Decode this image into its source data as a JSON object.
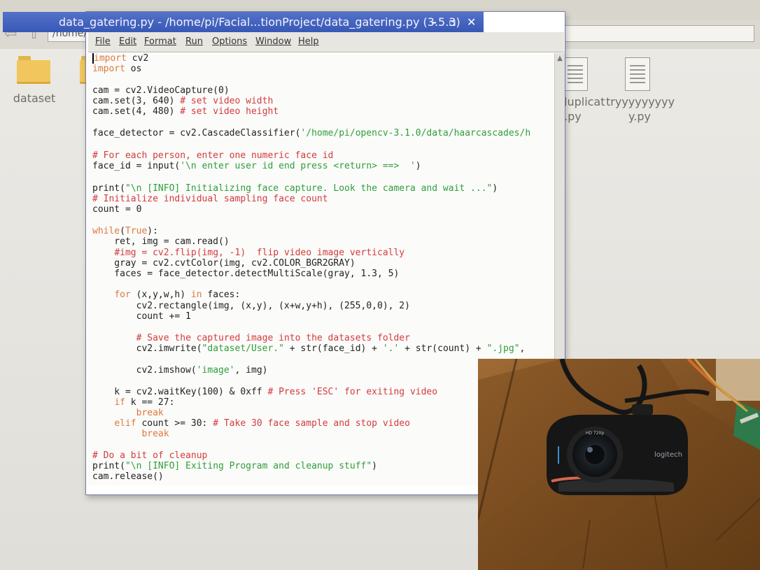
{
  "file_manager": {
    "path": "/home/",
    "items": [
      {
        "label": "dataset"
      },
      {
        "label": "luplicat\n.py"
      },
      {
        "label": "tryyyyyyyyy\ny.py"
      }
    ]
  },
  "idle_window": {
    "title": "data_gatering.py - /home/pi/Facial...tionProject/data_gatering.py (3.5.3)",
    "controls": {
      "minimize": "–",
      "maximize": "▫",
      "close": "✕"
    },
    "menus": [
      "File",
      "Edit",
      "Format",
      "Run",
      "Options",
      "Window",
      "Help"
    ]
  },
  "code": [
    [
      {
        "t": "import",
        "c": "kw"
      },
      {
        "t": " cv2",
        "c": ""
      }
    ],
    [
      {
        "t": "import",
        "c": "kw"
      },
      {
        "t": " os",
        "c": ""
      }
    ],
    [],
    [
      {
        "t": "cam = cv2.VideoCapture(0)",
        "c": ""
      }
    ],
    [
      {
        "t": "cam.set(3, 640) ",
        "c": ""
      },
      {
        "t": "# set video width",
        "c": "cm"
      }
    ],
    [
      {
        "t": "cam.set(4, 480) ",
        "c": ""
      },
      {
        "t": "# set video height",
        "c": "cm"
      }
    ],
    [],
    [
      {
        "t": "face_detector = cv2.CascadeClassifier(",
        "c": ""
      },
      {
        "t": "'/home/pi/opencv-3.1.0/data/haarcascades/h",
        "c": "st"
      }
    ],
    [],
    [
      {
        "t": "# For each person, enter one numeric face id",
        "c": "cm"
      }
    ],
    [
      {
        "t": "face_id = input(",
        "c": ""
      },
      {
        "t": "'\\n enter user id end press <return> ==>  '",
        "c": "st"
      },
      {
        "t": ")",
        "c": ""
      }
    ],
    [],
    [
      {
        "t": "print(",
        "c": ""
      },
      {
        "t": "\"\\n [INFO] Initializing face capture. Look the camera and wait ...\"",
        "c": "st"
      },
      {
        "t": ")",
        "c": ""
      }
    ],
    [
      {
        "t": "# Initialize individual sampling face count",
        "c": "cm"
      }
    ],
    [
      {
        "t": "count = 0",
        "c": ""
      }
    ],
    [],
    [
      {
        "t": "while",
        "c": "kw"
      },
      {
        "t": "(",
        "c": ""
      },
      {
        "t": "True",
        "c": "kw"
      },
      {
        "t": "):",
        "c": ""
      }
    ],
    [
      {
        "t": "    ret, img = cam.read()",
        "c": ""
      }
    ],
    [
      {
        "t": "    ",
        "c": ""
      },
      {
        "t": "#img = cv2.flip(img, -1)  flip video image vertically",
        "c": "cm"
      }
    ],
    [
      {
        "t": "    gray = cv2.cvtColor(img, cv2.COLOR_BGR2GRAY)",
        "c": ""
      }
    ],
    [
      {
        "t": "    faces = face_detector.detectMultiScale(gray, 1.3, 5)",
        "c": ""
      }
    ],
    [],
    [
      {
        "t": "    ",
        "c": ""
      },
      {
        "t": "for",
        "c": "kw"
      },
      {
        "t": " (x,y,w,h) ",
        "c": ""
      },
      {
        "t": "in",
        "c": "kw"
      },
      {
        "t": " faces:",
        "c": ""
      }
    ],
    [
      {
        "t": "        cv2.rectangle(img, (x,y), (x+w,y+h), (255,0,0), 2)",
        "c": ""
      }
    ],
    [
      {
        "t": "        count += 1",
        "c": ""
      }
    ],
    [],
    [
      {
        "t": "        ",
        "c": ""
      },
      {
        "t": "# Save the captured image into the datasets folder",
        "c": "cm"
      }
    ],
    [
      {
        "t": "        cv2.imwrite(",
        "c": ""
      },
      {
        "t": "\"dataset/User.\"",
        "c": "st"
      },
      {
        "t": " + str(face_id) + ",
        "c": ""
      },
      {
        "t": "'.'",
        "c": "st"
      },
      {
        "t": " + str(count) + ",
        "c": ""
      },
      {
        "t": "\".jpg\"",
        "c": "st"
      },
      {
        "t": ",",
        "c": ""
      }
    ],
    [],
    [
      {
        "t": "        cv2.imshow(",
        "c": ""
      },
      {
        "t": "'image'",
        "c": "st"
      },
      {
        "t": ", img)",
        "c": ""
      }
    ],
    [],
    [
      {
        "t": "    k = cv2.waitKey(100) & 0xff ",
        "c": ""
      },
      {
        "t": "# Press 'ESC' for exiting video",
        "c": "cm"
      }
    ],
    [
      {
        "t": "    ",
        "c": ""
      },
      {
        "t": "if",
        "c": "kw"
      },
      {
        "t": " k == 27:",
        "c": ""
      }
    ],
    [
      {
        "t": "        ",
        "c": ""
      },
      {
        "t": "break",
        "c": "kw"
      }
    ],
    [
      {
        "t": "    ",
        "c": ""
      },
      {
        "t": "elif",
        "c": "kw"
      },
      {
        "t": " count >= 30: ",
        "c": ""
      },
      {
        "t": "# Take 30 face sample and stop video",
        "c": "cm"
      }
    ],
    [
      {
        "t": "         ",
        "c": ""
      },
      {
        "t": "break",
        "c": "kw"
      }
    ],
    [],
    [
      {
        "t": "# Do a bit of cleanup",
        "c": "cm"
      }
    ],
    [
      {
        "t": "print(",
        "c": ""
      },
      {
        "t": "\"\\n [INFO] Exiting Program and cleanup stuff\"",
        "c": "st"
      },
      {
        "t": ")",
        "c": ""
      }
    ],
    [
      {
        "t": "cam.release()",
        "c": ""
      }
    ]
  ],
  "photo": {
    "camera_badge": "HD 720p",
    "camera_brand": "logitech"
  }
}
